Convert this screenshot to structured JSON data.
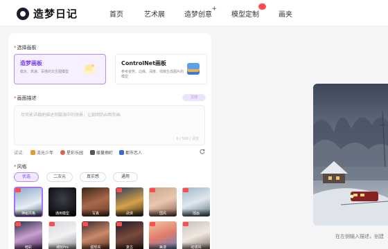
{
  "brand": {
    "name": "造梦日记"
  },
  "nav": [
    {
      "label": "首页",
      "marker": ""
    },
    {
      "label": "艺术展",
      "marker": ""
    },
    {
      "label": "造梦创意",
      "marker": "+"
    },
    {
      "label": "模型定制",
      "marker": "badge"
    },
    {
      "label": "画夹",
      "marker": ""
    }
  ],
  "board_section": {
    "label": "选择画板",
    "options": [
      {
        "title": "造梦画板",
        "desc": "稳定、高速、百搭的文生图模型",
        "selected": true
      },
      {
        "title": "ControlNet画板",
        "desc": "参考姿势、边缘、深度、线稿生成图片的模型",
        "selected": false
      }
    ]
  },
  "prompt_section": {
    "label": "画面描述",
    "enhance_label": "灵感",
    "placeholder": "尽可能详细地描述你脑海中的场景，让聪明的AI帮你画",
    "count": "0 / 500",
    "clear_label": "清空"
  },
  "try_row": {
    "label": "试试:",
    "chips": [
      {
        "label": "流光少年",
        "color": "#e39b2b"
      },
      {
        "label": "星彩乐园",
        "color": "#d06a4a"
      },
      {
        "label": "藤蔓摘町",
        "color": "#555555"
      },
      {
        "label": "都市恋人",
        "color": "#3a6bd1"
      }
    ]
  },
  "style_section": {
    "label": "风格",
    "tabs": [
      "优选",
      "二次元",
      "真实感",
      "通用"
    ],
    "tiles_row1": [
      "神秘风格",
      "通用模型",
      "写真",
      "武侠",
      "国风",
      "插画"
    ],
    "tiles_row2": [
      "暗彩",
      "潮玩Pro",
      "超现实",
      "复古",
      "美漫",
      "动漫风"
    ]
  },
  "right_panel": {
    "hint": "在左侧输入描述，创建"
  }
}
